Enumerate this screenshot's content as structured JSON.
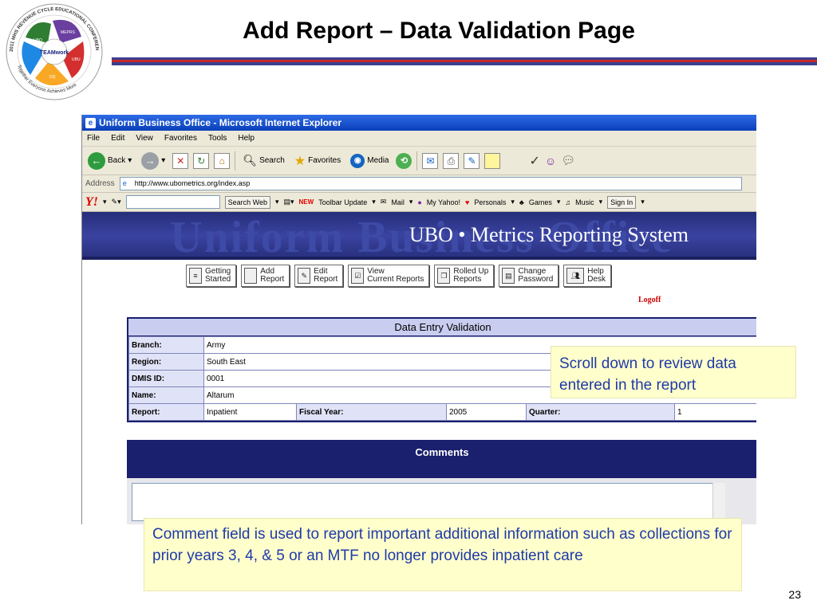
{
  "slide": {
    "title": "Add Report – Data Validation Page",
    "number": "23",
    "logo": {
      "ring_text": "2011 MHS REVENUE CYCLE EDUCATIONAL CONFERENCE",
      "center": "TEAMwork",
      "tagline": "Together Everyone Achieves More",
      "hands": [
        "UBO",
        "MEPRS",
        "UBU",
        "DQ"
      ]
    }
  },
  "browser": {
    "window_title": "Uniform Business Office - Microsoft Internet Explorer",
    "menu": [
      "File",
      "Edit",
      "View",
      "Favorites",
      "Tools",
      "Help"
    ],
    "toolbar": {
      "back": "Back",
      "search": "Search",
      "favorites": "Favorites",
      "media": "Media"
    },
    "address_label": "Address",
    "address_value": "http://www.ubometrics.org/index.asp",
    "yahoo": {
      "logo": "Y!",
      "search_button": "Search Web",
      "items": [
        "Toolbar Update",
        "Mail",
        "My Yahoo!",
        "Personals",
        "Games",
        "Music"
      ],
      "sign_in": "Sign In"
    }
  },
  "page": {
    "banner_bg_text": "Uniform Business Office",
    "banner_title": "UBO • Metrics Reporting System",
    "nav": [
      {
        "label": "Getting\nStarted"
      },
      {
        "label": "Add\nReport"
      },
      {
        "label": "Edit\nReport"
      },
      {
        "label": "View\nCurrent Reports"
      },
      {
        "label": "Rolled Up\nReports"
      },
      {
        "label": "Change\nPassword"
      },
      {
        "label": "Help\nDesk"
      }
    ],
    "logoff": "Logoff",
    "validation": {
      "title": "Data Entry Validation",
      "branch_label": "Branch:",
      "branch": "Army",
      "region_label": "Region:",
      "region": "South East",
      "dmis_label": "DMIS ID:",
      "dmis": "0001",
      "name_label": "Name:",
      "name": "Altarum",
      "report_label": "Report:",
      "report": "Inpatient",
      "fiscal_label": "Fiscal Year:",
      "fiscal": "2005",
      "quarter_label": "Quarter:",
      "quarter": "1"
    },
    "comments_title": "Comments"
  },
  "callouts": {
    "scroll": "Scroll down to review data entered in the report",
    "comment": "Comment field is used to report important additional information such as collections for prior years 3, 4, & 5 or an MTF no longer provides inpatient care"
  }
}
